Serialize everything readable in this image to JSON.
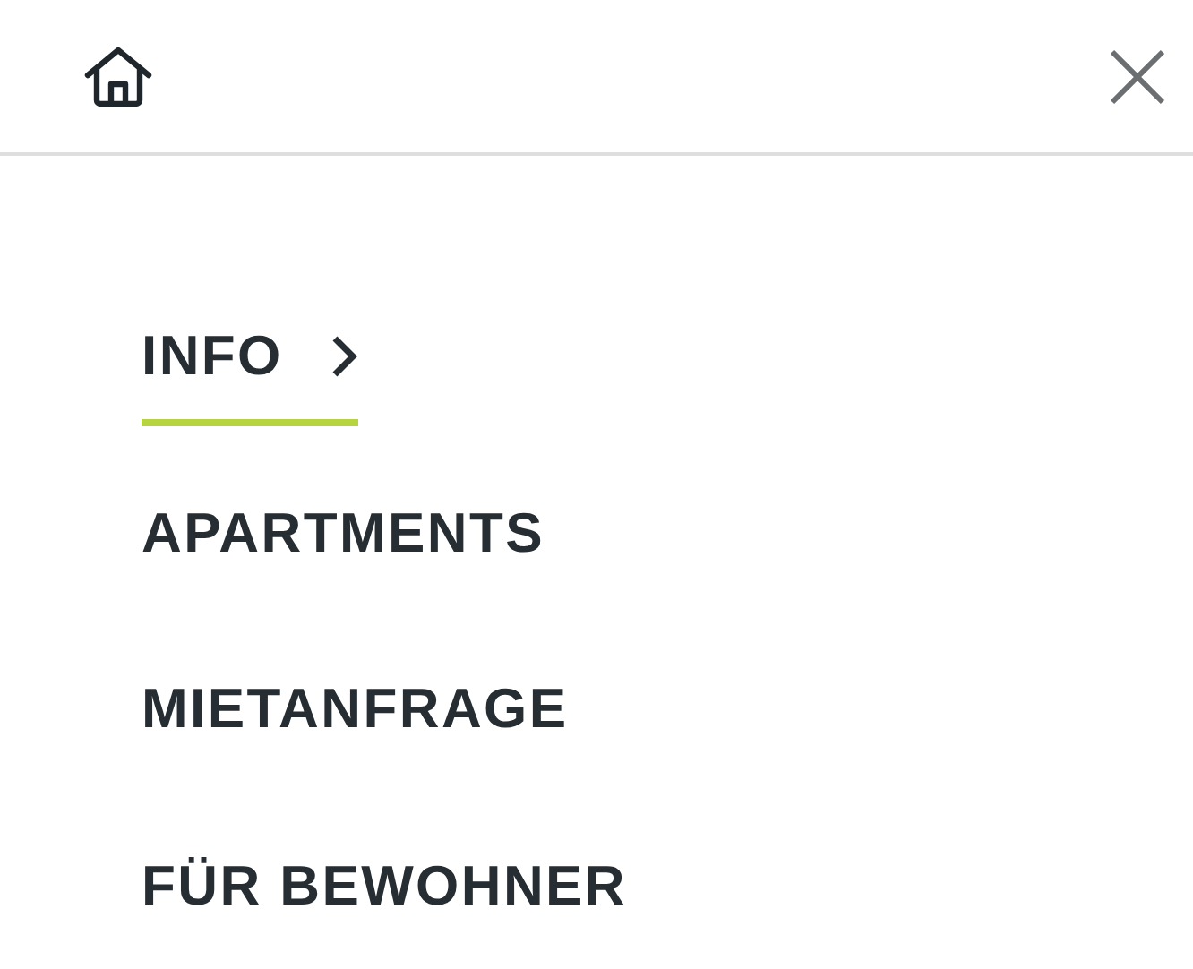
{
  "menu": [
    {
      "label": "INFO",
      "selected": true,
      "has_submenu": true
    },
    {
      "label": "APARTMENTS",
      "selected": false,
      "has_submenu": false
    },
    {
      "label": "MIETANFRAGE",
      "selected": false,
      "has_submenu": false
    },
    {
      "label": "FÜR BEWOHNER",
      "selected": false,
      "has_submenu": false
    }
  ]
}
